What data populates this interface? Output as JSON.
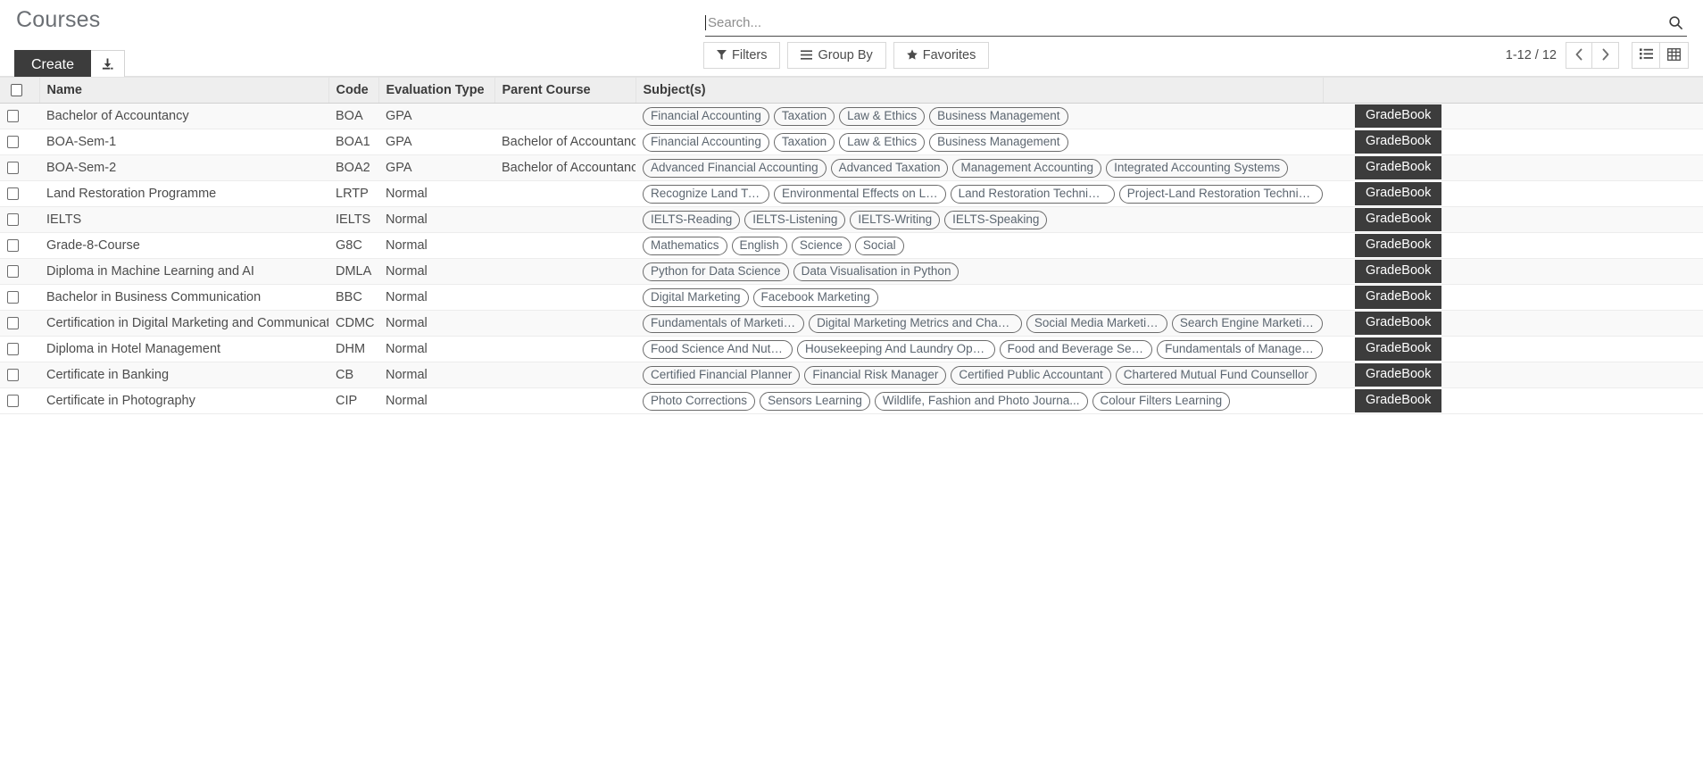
{
  "control_panel": {
    "title": "Courses",
    "create_label": "Create",
    "upload_icon": "download-arrow-icon",
    "search": {
      "placeholder": "Search...",
      "value": "",
      "icon": "search-icon"
    },
    "filter_buttons": [
      {
        "label": "Filters",
        "icon": "funnel-icon"
      },
      {
        "label": "Group By",
        "icon": "hamburger-icon"
      },
      {
        "label": "Favorites",
        "icon": "star-icon"
      }
    ],
    "pager": {
      "range": "1-12 / 12",
      "previous_icon": "chevron-left-icon",
      "next_icon": "chevron-right-icon"
    },
    "view_switcher": [
      {
        "name": "list-view",
        "icon": "list-icon",
        "active": true
      },
      {
        "name": "grid-view",
        "icon": "table-grid-icon",
        "active": false
      }
    ]
  },
  "table": {
    "columns": [
      {
        "key": "select",
        "label": ""
      },
      {
        "key": "name",
        "label": "Name"
      },
      {
        "key": "code",
        "label": "Code"
      },
      {
        "key": "evaluation_type",
        "label": "Evaluation Type"
      },
      {
        "key": "parent_course",
        "label": "Parent Course"
      },
      {
        "key": "subjects",
        "label": "Subject(s)"
      },
      {
        "key": "gradebook",
        "label": ""
      }
    ],
    "gradebook_label": "GradeBook",
    "rows": [
      {
        "name": "Bachelor of Accountancy",
        "code": "BOA",
        "evaluation_type": "GPA",
        "parent_course": "",
        "subjects": [
          "Financial Accounting",
          "Taxation",
          "Law & Ethics",
          "Business Management"
        ]
      },
      {
        "name": "BOA-Sem-1",
        "code": "BOA1",
        "evaluation_type": "GPA",
        "parent_course": "Bachelor of Accountancy",
        "subjects": [
          "Financial Accounting",
          "Taxation",
          "Law & Ethics",
          "Business Management"
        ]
      },
      {
        "name": "BOA-Sem-2",
        "code": "BOA2",
        "evaluation_type": "GPA",
        "parent_course": "Bachelor of Accountancy",
        "subjects": [
          "Advanced Financial Accounting",
          "Advanced Taxation",
          "Management Accounting",
          "Integrated Accounting Systems"
        ]
      },
      {
        "name": "Land Restoration Programme",
        "code": "LRTP",
        "evaluation_type": "Normal",
        "parent_course": "",
        "subjects": [
          "Recognize Land Type",
          "Environmental Effects on Land",
          "Land Restoration Techniques",
          "Project-Land Restoration Techniques"
        ]
      },
      {
        "name": "IELTS",
        "code": "IELTS",
        "evaluation_type": "Normal",
        "parent_course": "",
        "subjects": [
          "IELTS-Reading",
          "IELTS-Listening",
          "IELTS-Writing",
          "IELTS-Speaking"
        ]
      },
      {
        "name": "Grade-8-Course",
        "code": "G8C",
        "evaluation_type": "Normal",
        "parent_course": "",
        "subjects": [
          "Mathematics",
          "English",
          "Science",
          "Social"
        ]
      },
      {
        "name": "Diploma in Machine Learning and AI",
        "code": "DMLA",
        "evaluation_type": "Normal",
        "parent_course": "",
        "subjects": [
          "Python for Data Science",
          "Data Visualisation in Python"
        ]
      },
      {
        "name": "Bachelor in Business Communication",
        "code": "BBC",
        "evaluation_type": "Normal",
        "parent_course": "",
        "subjects": [
          "Digital Marketing",
          "Facebook Marketing"
        ]
      },
      {
        "name": "Certification in Digital Marketing and Communication",
        "code": "CDMC",
        "evaluation_type": "Normal",
        "parent_course": "",
        "subjects": [
          "Fundamentals of Marketing",
          "Digital Marketing Metrics and Chan...",
          "Social Media Marketing",
          "Search Engine Marketing"
        ]
      },
      {
        "name": "Diploma in Hotel Management",
        "code": "DHM",
        "evaluation_type": "Normal",
        "parent_course": "",
        "subjects": [
          "Food Science And Nutrition",
          "Housekeeping And Laundry Operat...",
          "Food and Beverage Service",
          "Fundamentals of Management"
        ]
      },
      {
        "name": "Certificate in Banking",
        "code": "CB",
        "evaluation_type": "Normal",
        "parent_course": "",
        "subjects": [
          "Certified Financial Planner",
          "Financial Risk Manager",
          "Certified Public Accountant",
          "Chartered Mutual Fund Counsellor"
        ]
      },
      {
        "name": "Certificate in Photography",
        "code": "CIP",
        "evaluation_type": "Normal",
        "parent_course": "",
        "subjects": [
          "Photo Corrections",
          "Sensors Learning",
          "Wildlife, Fashion and Photo Journa...",
          "Colour Filters Learning"
        ]
      }
    ]
  },
  "colors": {
    "dark_button": "#3c3c3c",
    "header_bg": "#eeeeee",
    "text": "#4c4c4c",
    "tag_border": "#6b6b6b",
    "page_bg": "#ffffff"
  }
}
